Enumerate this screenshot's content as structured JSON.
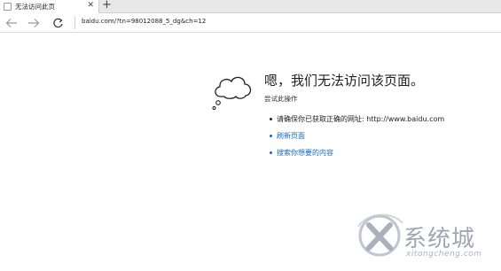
{
  "tab": {
    "title": "无法访问此页",
    "close": "✕",
    "new_tab": "+"
  },
  "nav": {
    "url": "baidu.com/?tn=98012088_5_dg&ch=12"
  },
  "error": {
    "title": "嗯，我们无法访问该页面。",
    "subtitle": "尝试此操作",
    "suggestions": [
      {
        "text": "请确保你已获取正确的网址: http://www.baidu.com"
      },
      {
        "text": "刷新页面"
      },
      {
        "text": "搜索你想要的内容"
      }
    ]
  },
  "watermark": {
    "logo": "系统城",
    "site": "xitongcheng.com"
  },
  "colors": {
    "link": "#1668c9",
    "tabstrip": "#e8e8e8"
  },
  "icons": {
    "back": "back-arrow-icon",
    "forward": "forward-arrow-icon",
    "refresh": "refresh-icon",
    "cloud": "cloud-icon"
  }
}
